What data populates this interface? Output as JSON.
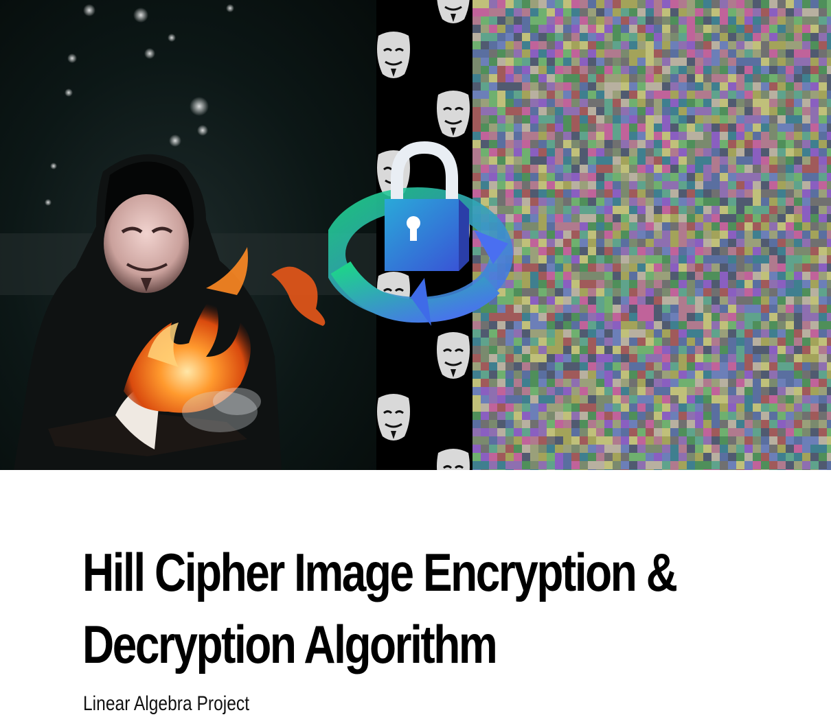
{
  "cover": {
    "title_line1": "Hill Cipher Image Encryption &",
    "title_line2": "Decryption Algorithm",
    "subtitle": "Linear Algebra Project"
  },
  "hero": {
    "left_panel": "hooded-figure-burning-book",
    "center_strip": "mask-pattern",
    "right_panel": "encrypted-noise",
    "center_icon": "padlock-refresh-icon"
  },
  "colors": {
    "background": "#ffffff",
    "text": "#000000",
    "strip": "#000000",
    "lock_body": "#2e6fd6",
    "lock_shackle": "#e9eef4",
    "arrow_green": "#1ed38a",
    "arrow_blue": "#4a6ff0"
  }
}
